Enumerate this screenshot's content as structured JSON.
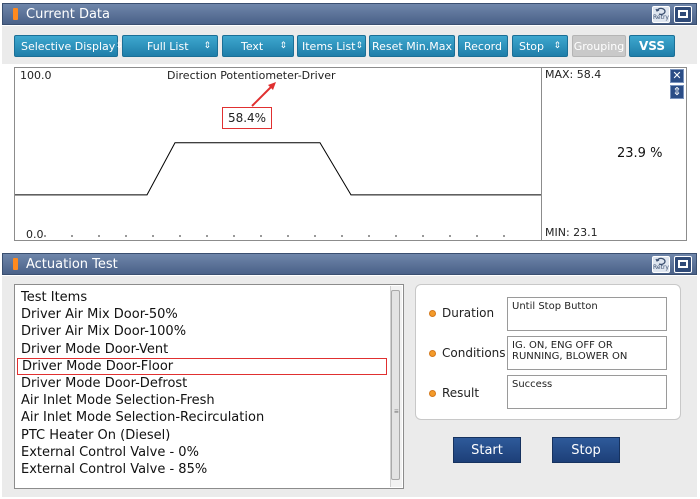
{
  "current_data": {
    "title": "Current Data",
    "retry_label": "Retry",
    "toolbar": [
      {
        "label": "Selective Display",
        "has_select": true
      },
      {
        "label": "Full List",
        "has_select": true
      },
      {
        "label": "Text",
        "has_select": true
      },
      {
        "label": "Items List",
        "has_select": true
      },
      {
        "label": "Reset Min.Max",
        "has_select": false
      },
      {
        "label": "Record",
        "has_select": false
      },
      {
        "label": "Stop",
        "has_select": true
      },
      {
        "label": "Grouping",
        "has_select": false,
        "disabled": true
      },
      {
        "label": "VSS",
        "has_select": false
      }
    ],
    "select_arrow": "⇕",
    "graph": {
      "title": "Direction Potentiometer-Driver",
      "y_max_label": "100.0",
      "y_min_label": "0.0",
      "max_label": "MAX: 58.4",
      "min_label": "MIN: 23.1",
      "callout_value": "58.4%",
      "current_value": "23.9 %",
      "series_values": [
        23.9,
        23.9,
        58.4,
        58.4,
        23.9,
        23.9
      ],
      "line_color": "#000000",
      "close_icon_glyph": "✕",
      "expand_icon_glyph": "⇕"
    }
  },
  "actuation_test": {
    "title": "Actuation Test",
    "retry_label": "Retry",
    "list_header": "Test Items",
    "items": [
      "Driver Air Mix Door-50%",
      "Driver Air Mix Door-100%",
      "Driver Mode Door-Vent",
      "Driver Mode Door-Floor",
      "Driver Mode Door-Defrost",
      "Air Inlet Mode Selection-Fresh",
      "Air Inlet Mode Selection-Recirculation",
      "PTC Heater On (Diesel)",
      "External Control Valve - 0%",
      "External Control Valve - 85%"
    ],
    "selected_index": 3,
    "duration_label": "Duration",
    "duration_value": "Until Stop Button",
    "conditions_label": "Conditions",
    "conditions_value": "IG. ON, ENG OFF OR RUNNING, BLOWER ON",
    "result_label": "Result",
    "result_value": "Success",
    "start_label": "Start",
    "stop_label": "Stop"
  },
  "colors": {
    "header": "#4a6188",
    "toolbar_button": "#1f7ea9",
    "action_button": "#1d3f78",
    "highlight": "#e03030",
    "bullet": "#f49b2a"
  }
}
